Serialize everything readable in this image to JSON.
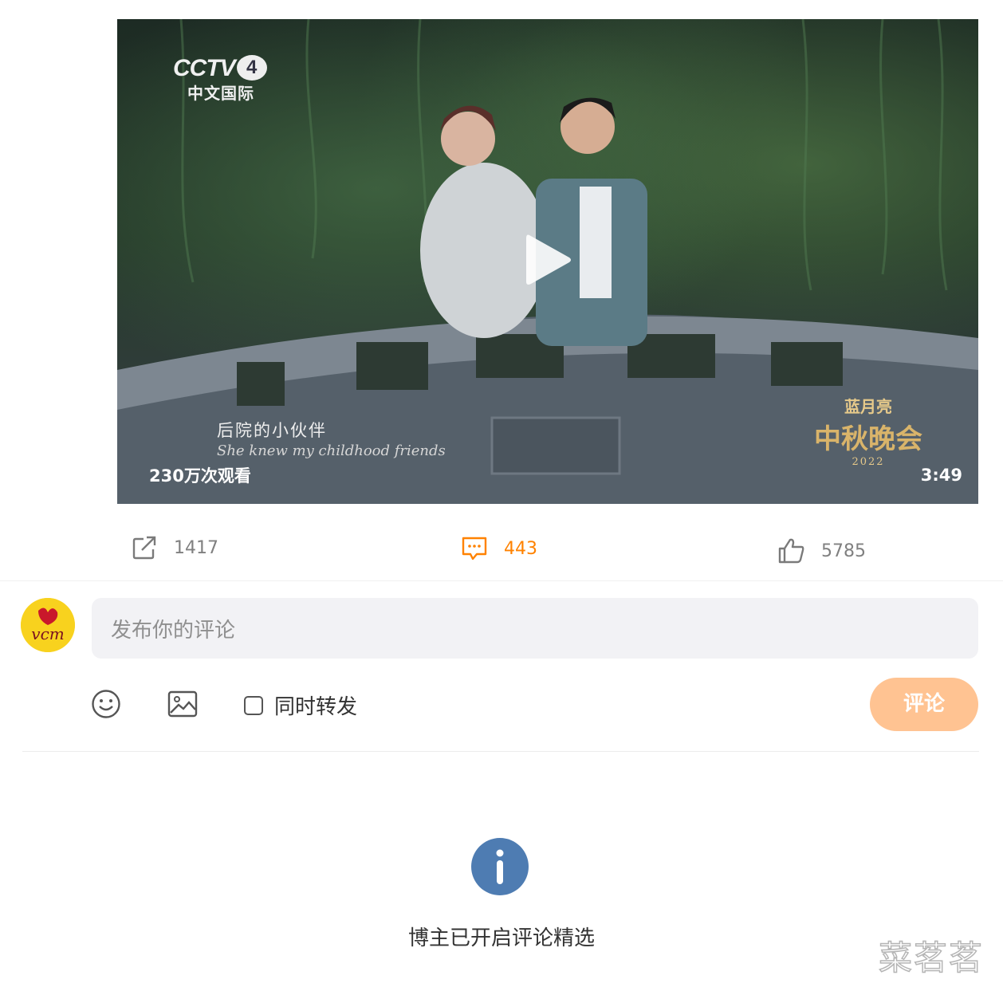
{
  "video": {
    "channel_logo": "CCTV",
    "channel_number": "4",
    "channel_name": "中文国际",
    "subtitle_cn": "后院的小伙伴",
    "subtitle_en": "She knew my childhood friends",
    "gala_logo_line1": "蓝月亮",
    "gala_logo_line2": "中秋晚会",
    "gala_logo_line3": "2022",
    "view_count": "230万次观看",
    "duration": "3:49",
    "play_icon": "play-icon"
  },
  "actions": {
    "repost_count": "1417",
    "comment_count": "443",
    "like_count": "5785",
    "repost_icon": "share-icon",
    "comment_icon": "comment-icon",
    "like_icon": "thumbs-up-icon",
    "accent_color": "#ff8200"
  },
  "composer": {
    "avatar_text": "vcm",
    "placeholder": "发布你的评论",
    "emoji_icon": "smiley-icon",
    "image_icon": "image-icon",
    "repost_toggle_label": "同时转发",
    "repost_toggle_checked": false,
    "submit_label": "评论",
    "submit_color": "#ffc392"
  },
  "notice": {
    "icon": "info-icon",
    "text": "博主已开启评论精选"
  },
  "watermark": "菜茗茗"
}
